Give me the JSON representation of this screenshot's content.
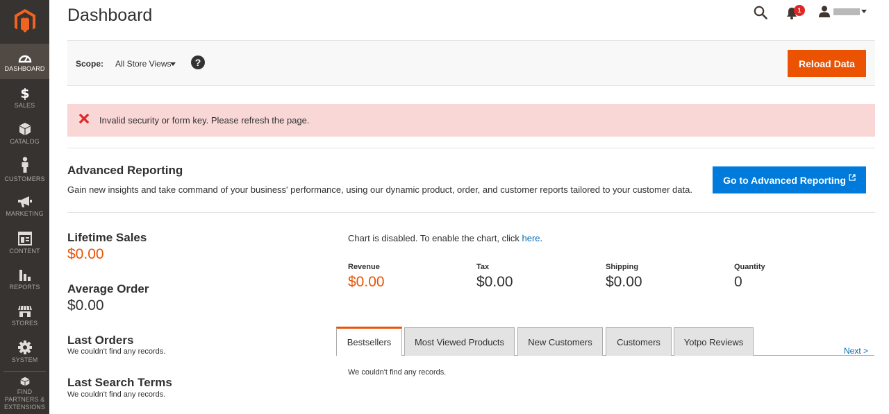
{
  "sidebar": {
    "items": [
      {
        "label": "DASHBOARD",
        "icon": "dashboard-icon"
      },
      {
        "label": "SALES",
        "icon": "dollar-icon"
      },
      {
        "label": "CATALOG",
        "icon": "box-icon"
      },
      {
        "label": "CUSTOMERS",
        "icon": "person-icon"
      },
      {
        "label": "MARKETING",
        "icon": "megaphone-icon"
      },
      {
        "label": "CONTENT",
        "icon": "content-icon"
      },
      {
        "label": "REPORTS",
        "icon": "bar-chart-icon"
      },
      {
        "label": "STORES",
        "icon": "store-icon"
      },
      {
        "label": "SYSTEM",
        "icon": "gear-icon"
      },
      {
        "label": "FIND PARTNERS & EXTENSIONS",
        "icon": "extensions-icon"
      }
    ]
  },
  "header": {
    "title": "Dashboard",
    "notification_count": "1"
  },
  "scope": {
    "label": "Scope:",
    "selected": "All Store Views",
    "help": "?",
    "reload_label": "Reload Data"
  },
  "message": {
    "text": "Invalid security or form key. Please refresh the page."
  },
  "advanced": {
    "title": "Advanced Reporting",
    "description": "Gain new insights and take command of your business' performance, using our dynamic product, order, and customer reports tailored to your customer data.",
    "button_label": "Go to Advanced Reporting"
  },
  "stats": {
    "lifetime_title": "Lifetime Sales",
    "lifetime_value": "$0.00",
    "average_title": "Average Order",
    "average_value": "$0.00",
    "last_orders_title": "Last Orders",
    "last_orders_empty": "We couldn't find any records.",
    "last_search_title": "Last Search Terms",
    "last_search_empty": "We couldn't find any records."
  },
  "chart": {
    "note_prefix": "Chart is disabled. To enable the chart, click ",
    "note_link": "here",
    "note_suffix": "."
  },
  "totals": [
    {
      "label": "Revenue",
      "value": "$0.00"
    },
    {
      "label": "Tax",
      "value": "$0.00"
    },
    {
      "label": "Shipping",
      "value": "$0.00"
    },
    {
      "label": "Quantity",
      "value": "0"
    }
  ],
  "tabs": {
    "items": [
      {
        "label": "Bestsellers",
        "active": true
      },
      {
        "label": "Most Viewed Products"
      },
      {
        "label": "New Customers"
      },
      {
        "label": "Customers"
      },
      {
        "label": "Yotpo Reviews"
      }
    ],
    "next_label": "Next >",
    "empty_text": "We couldn't find any records."
  },
  "colors": {
    "accent": "#eb5202",
    "link": "#006bb4",
    "primary_button": "#007bdb",
    "sidebar": "#373330",
    "error_bg": "#fad7d7",
    "error_icon": "#e22626"
  }
}
